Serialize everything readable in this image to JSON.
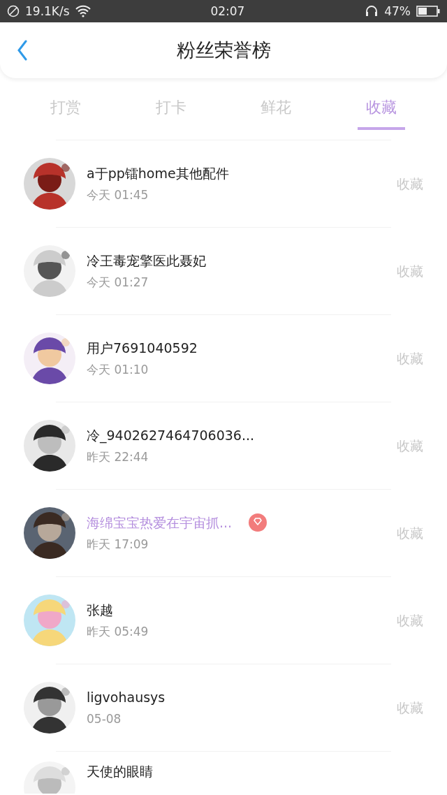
{
  "status_bar": {
    "speed": "19.1K/s",
    "time": "02:07",
    "battery": "47%"
  },
  "header": {
    "title": "粉丝荣誉榜"
  },
  "tabs": [
    {
      "label": "打赏",
      "selected": false
    },
    {
      "label": "打卡",
      "selected": false
    },
    {
      "label": "鲜花",
      "selected": false
    },
    {
      "label": "收藏",
      "selected": true
    }
  ],
  "rows": [
    {
      "name": "a于pp镭home其他配件",
      "time": "今天 01:45",
      "action": "收藏",
      "vip": false
    },
    {
      "name": "冷王毒宠擎医此聂妃",
      "time": "今天 01:27",
      "action": "收藏",
      "vip": false
    },
    {
      "name": "用户7691040592",
      "time": "今天 01:10",
      "action": "收藏",
      "vip": false
    },
    {
      "name": "冷_9402627464706036...",
      "time": "昨天 22:44",
      "action": "收藏",
      "vip": false
    },
    {
      "name": "海绵宝宝热爱在宇宙抓...",
      "time": "昨天 17:09",
      "action": "收藏",
      "vip": true
    },
    {
      "name": "张越",
      "time": "昨天 05:49",
      "action": "收藏",
      "vip": false
    },
    {
      "name": "ligvohausys",
      "time": "05-08",
      "action": "收藏",
      "vip": false
    },
    {
      "name": "天使的眼睛"
    }
  ]
}
